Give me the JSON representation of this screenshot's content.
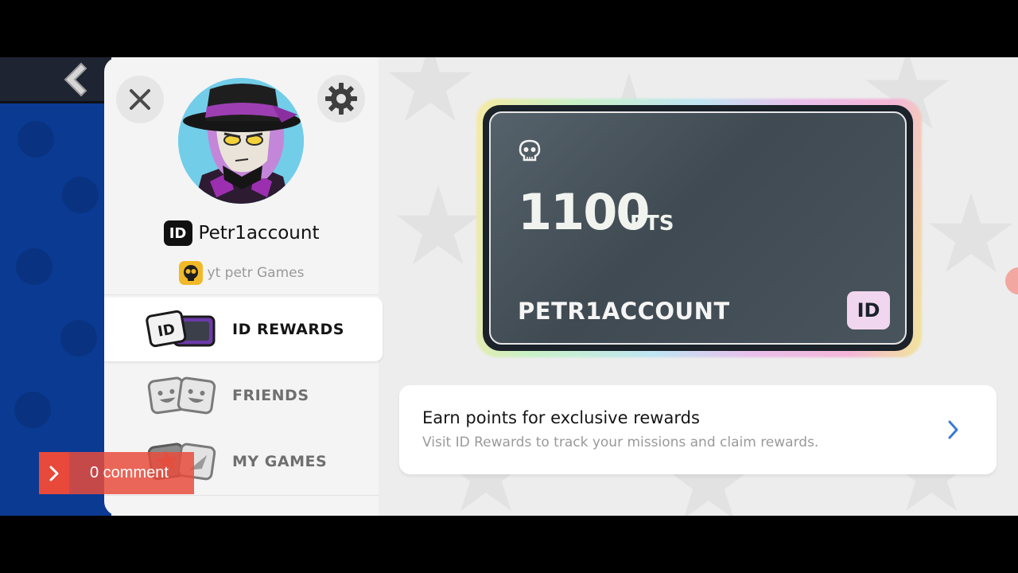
{
  "profile": {
    "username": "Petr1account",
    "id_badge": "ID",
    "linked_game_name": "yt petr Games"
  },
  "menu": {
    "items": [
      {
        "label": "ID REWARDS",
        "active": true
      },
      {
        "label": "FRIENDS",
        "active": false
      },
      {
        "label": "MY GAMES",
        "active": false
      }
    ]
  },
  "card": {
    "points": "1100",
    "points_unit": "PTS",
    "username": "PETR1ACCOUNT",
    "badge": "ID"
  },
  "info": {
    "title": "Earn points for exclusive rewards",
    "subtitle": "Visit ID Rewards to track your missions and claim rewards."
  },
  "overlay": {
    "comment_text": "0 comment"
  },
  "colors": {
    "game_blue": "#0b3a93",
    "card_dark": "#1b2229",
    "accent_blue": "#3a7bd5",
    "comment_red": "#e84c3d"
  }
}
